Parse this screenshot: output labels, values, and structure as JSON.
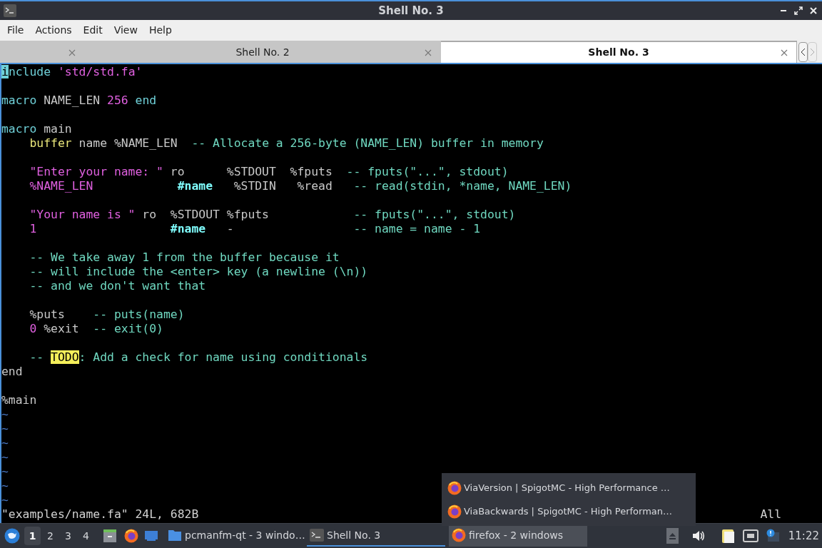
{
  "window": {
    "title": "Shell No. 3"
  },
  "menu": [
    "File",
    "Actions",
    "Edit",
    "View",
    "Help"
  ],
  "tabs": [
    {
      "selected": false
    },
    {
      "label": "Shell No. 2",
      "selected": false
    },
    {
      "label": "Shell No. 3",
      "selected": true
    }
  ],
  "editor": {
    "lines": [
      {
        "kind": "code",
        "indented": false,
        "segments": [
          {
            "kind": "cursor",
            "text": "i"
          },
          {
            "kind": "keyword",
            "text": "nclude "
          },
          {
            "kind": "string",
            "text": "'std/std.fa'"
          }
        ]
      },
      {
        "kind": "blank"
      },
      {
        "kind": "code",
        "indented": false,
        "segments": [
          {
            "kind": "keyword",
            "text": "macro"
          },
          {
            "kind": "plain",
            "text": " NAME_LEN "
          },
          {
            "kind": "number",
            "text": "256 "
          },
          {
            "kind": "keyword",
            "text": "end"
          }
        ]
      },
      {
        "kind": "blank"
      },
      {
        "kind": "code",
        "indented": false,
        "segments": [
          {
            "kind": "keyword",
            "text": "macro"
          },
          {
            "kind": "plain",
            "text": " main"
          }
        ]
      },
      {
        "kind": "code",
        "indented": true,
        "segments": [
          {
            "kind": "type",
            "text": "buffer"
          },
          {
            "kind": "plain",
            "text": " name %NAME_LEN  "
          },
          {
            "kind": "comment",
            "text": "-- Allocate a 256-byte (NAME_LEN) buffer in memory"
          }
        ]
      },
      {
        "kind": "blank"
      },
      {
        "kind": "code",
        "indented": true,
        "segments": [
          {
            "kind": "string",
            "text": "\"Enter your name: \""
          },
          {
            "kind": "plain",
            "text": " ro      %STDOUT  %fputs  "
          },
          {
            "kind": "comment",
            "text": "-- fputs(\"...\", stdout)"
          }
        ]
      },
      {
        "kind": "code",
        "indented": true,
        "segments": [
          {
            "kind": "string",
            "text": "%NAME_LEN            "
          },
          {
            "kind": "label",
            "text": "#name"
          },
          {
            "kind": "plain",
            "text": "   %STDIN   %read   "
          },
          {
            "kind": "comment",
            "text": "-- read(stdin, *name, NAME_LEN)"
          }
        ]
      },
      {
        "kind": "blank"
      },
      {
        "kind": "code",
        "indented": true,
        "segments": [
          {
            "kind": "string",
            "text": "\"Your name is \""
          },
          {
            "kind": "plain",
            "text": " ro  %STDOUT %fputs            "
          },
          {
            "kind": "comment",
            "text": "-- fputs(\"...\", stdout)"
          }
        ]
      },
      {
        "kind": "code",
        "indented": true,
        "segments": [
          {
            "kind": "number",
            "text": "1                   "
          },
          {
            "kind": "label",
            "text": "#name"
          },
          {
            "kind": "plain",
            "text": "   -                 "
          },
          {
            "kind": "comment",
            "text": "-- name = name - 1"
          }
        ]
      },
      {
        "kind": "blank"
      },
      {
        "kind": "code",
        "indented": true,
        "segments": [
          {
            "kind": "comment",
            "text": "-- We take away 1 from the buffer because it"
          }
        ]
      },
      {
        "kind": "code",
        "indented": true,
        "segments": [
          {
            "kind": "comment",
            "text": "-- will include the <enter> key (a newline (\\n))"
          }
        ]
      },
      {
        "kind": "code",
        "indented": true,
        "segments": [
          {
            "kind": "comment",
            "text": "-- and we don't want that"
          }
        ]
      },
      {
        "kind": "blank"
      },
      {
        "kind": "code",
        "indented": true,
        "segments": [
          {
            "kind": "plain",
            "text": "%puts    "
          },
          {
            "kind": "comment",
            "text": "-- puts(name)"
          }
        ]
      },
      {
        "kind": "code",
        "indented": true,
        "segments": [
          {
            "kind": "number",
            "text": "0"
          },
          {
            "kind": "plain",
            "text": " %exit  "
          },
          {
            "kind": "comment",
            "text": "-- exit(0)"
          }
        ]
      },
      {
        "kind": "blank"
      },
      {
        "kind": "code",
        "indented": true,
        "segments": [
          {
            "kind": "comment",
            "text": "-- "
          },
          {
            "kind": "todo",
            "text": "TODO"
          },
          {
            "kind": "comment",
            "text": ": Add a check for name using conditionals"
          }
        ]
      },
      {
        "kind": "code",
        "indented": false,
        "segments": [
          {
            "kind": "plain",
            "text": "end"
          }
        ]
      },
      {
        "kind": "blank"
      },
      {
        "kind": "code",
        "indented": false,
        "segments": [
          {
            "kind": "plain",
            "text": "%main"
          }
        ]
      },
      {
        "kind": "filler",
        "text": "~"
      },
      {
        "kind": "filler",
        "text": "~"
      },
      {
        "kind": "filler",
        "text": "~"
      },
      {
        "kind": "filler",
        "text": "~"
      },
      {
        "kind": "filler",
        "text": "~"
      },
      {
        "kind": "filler",
        "text": "~"
      },
      {
        "kind": "filler",
        "text": "~"
      }
    ],
    "status_line": "\"examples/name.fa\" 24L, 682B",
    "position": "All"
  },
  "taskbar": {
    "desktops": [
      {
        "label": "1",
        "selected": true
      },
      {
        "label": "2",
        "selected": false
      },
      {
        "label": "3",
        "selected": false
      },
      {
        "label": "4",
        "selected": false
      }
    ],
    "tasks": [
      {
        "kind": "folder",
        "label": "pcmanfm-qt - 3 windo…",
        "active": false,
        "selected": false
      },
      {
        "kind": "terminal",
        "label": "Shell No. 3",
        "active": true,
        "selected": false
      },
      {
        "kind": "firefox",
        "label": "firefox - 2 windows",
        "active": false,
        "selected": true
      }
    ],
    "popup": [
      "ViaVersion | SpigotMC - High Performance …",
      "ViaBackwards | SpigotMC - High Performan…"
    ],
    "clock": "11:22"
  }
}
